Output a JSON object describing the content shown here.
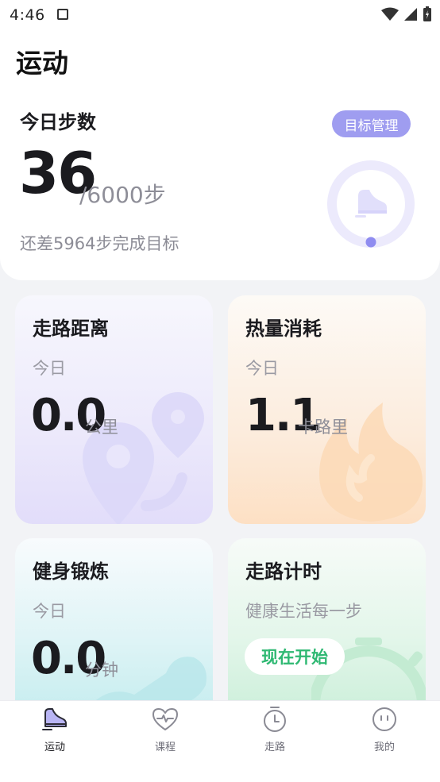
{
  "status_bar": {
    "time": "4:46"
  },
  "header": {
    "title": "运动"
  },
  "steps": {
    "title": "今日步数",
    "goal_button": "目标管理",
    "count": "36",
    "goal": "/6000步",
    "remaining": "还差5964步完成目标",
    "progress": 0.006
  },
  "cards": {
    "distance": {
      "title": "走路距离",
      "sub": "今日",
      "value": "0.0",
      "unit": "公里"
    },
    "calorie": {
      "title": "热量消耗",
      "sub": "今日",
      "value": "1.1",
      "unit": "卡路里"
    },
    "exercise": {
      "title": "健身锻炼",
      "sub": "今日",
      "value": "0.0",
      "unit": "分钟"
    },
    "timer": {
      "title": "走路计时",
      "sub": "健康生活每一步",
      "button": "现在开始"
    }
  },
  "nav": {
    "items": [
      {
        "label": "运动",
        "icon": "sneaker-icon",
        "active": true
      },
      {
        "label": "课程",
        "icon": "heart-pulse-icon",
        "active": false
      },
      {
        "label": "走路",
        "icon": "stopwatch-icon",
        "active": false
      },
      {
        "label": "我的",
        "icon": "face-icon",
        "active": false
      }
    ]
  },
  "colors": {
    "accent": "#9f9df0",
    "ring_track": "#eceafc",
    "ring_dot": "#8f8cf0",
    "start_text": "#2eb872"
  }
}
